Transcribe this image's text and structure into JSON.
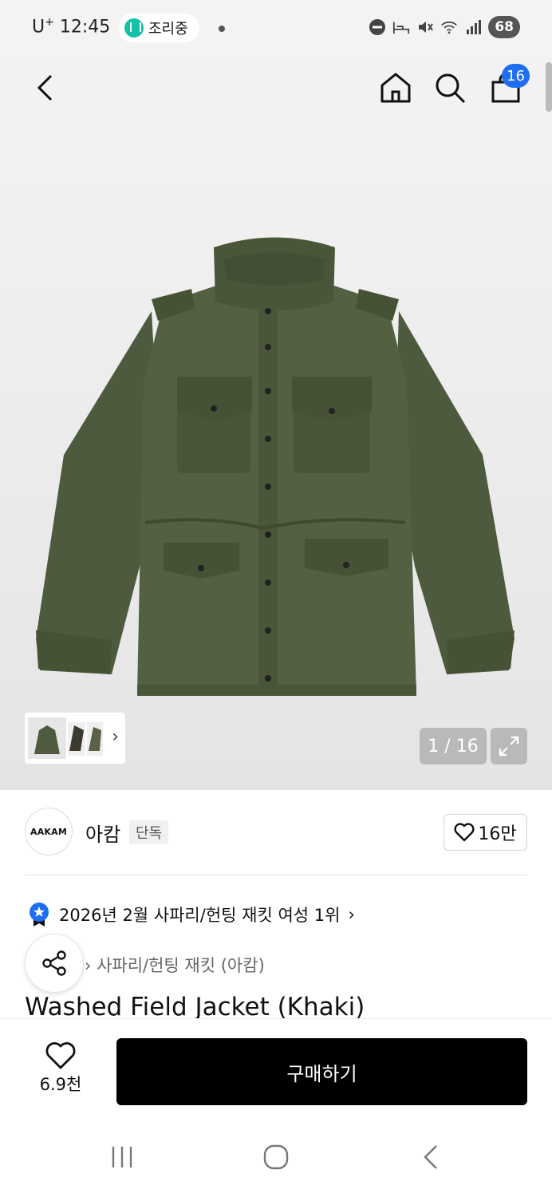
{
  "status_bar": {
    "carrier": "U",
    "carrier_sup": "+",
    "time": "12:45",
    "cooking_label": "조리중",
    "battery": "68"
  },
  "header": {
    "cart_count": "16"
  },
  "gallery": {
    "page_indicator": "1 / 16",
    "current_page": 1,
    "total_pages": 16
  },
  "brand": {
    "logo_text": "AAKAM",
    "name": "아캄",
    "tag": "단독",
    "likes": "16만"
  },
  "product": {
    "ranking": "2026년 2월 사파리/헌팅 재킷 여성 1위",
    "ranking_chevron": "›",
    "category": "› 사파리/헌팅 재킷 (아캄)",
    "title": "Washed Field Jacket (Khaki)"
  },
  "action_bar": {
    "wish_count": "6.9천",
    "buy_label": "구매하기"
  },
  "colors": {
    "accent_blue": "#1f6ef2",
    "jacket_khaki": "#4f5a3e",
    "buy_button": "#000000"
  }
}
